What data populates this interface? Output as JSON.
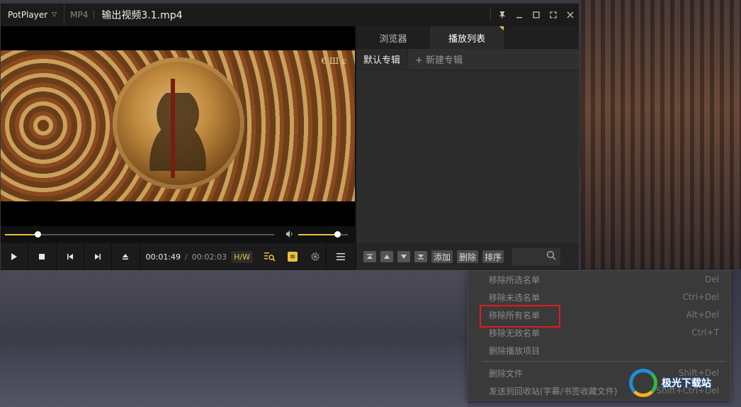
{
  "titlebar": {
    "app_name": "PotPlayer",
    "format": "MP4",
    "file_title": "输出视频3.1.mp4"
  },
  "video": {
    "stamp_text": "€ Ш ɕ"
  },
  "playback": {
    "progress_fraction": 0.12,
    "volume_fraction": 0.79,
    "current_time": "00:01:49",
    "separator": "/",
    "duration": "00:02:03",
    "hw_label": "H/W"
  },
  "panel": {
    "tabs": [
      "浏览器",
      "播放列表"
    ],
    "active_tab": "播放列表",
    "album_default": "默认专辑",
    "album_new": "+ 新建专辑",
    "footer_buttons": [
      "添加",
      "删除",
      "排序"
    ]
  },
  "context_menu": {
    "items": [
      {
        "label": "移除所选名单",
        "shortcut": "Del"
      },
      {
        "label": "移除未选名单",
        "shortcut": "Ctrl+Del"
      },
      {
        "label": "移除所有名单",
        "shortcut": "Alt+Del"
      },
      {
        "label": "移除无效名单",
        "shortcut": "Ctrl+T"
      },
      {
        "label": "删除播放项目",
        "shortcut": ""
      },
      {
        "label": "删除文件",
        "shortcut": "Shift+Del"
      },
      {
        "label": "发送到回收站(字幕/书签收藏文件)",
        "shortcut": "Shift+Ctrl+Del"
      }
    ],
    "highlighted_item": "移除所有名单"
  },
  "watermark": {
    "site_text": "极光下载站"
  },
  "colors": {
    "accent": "#e8c23c",
    "highlight": "#e21a1a"
  }
}
